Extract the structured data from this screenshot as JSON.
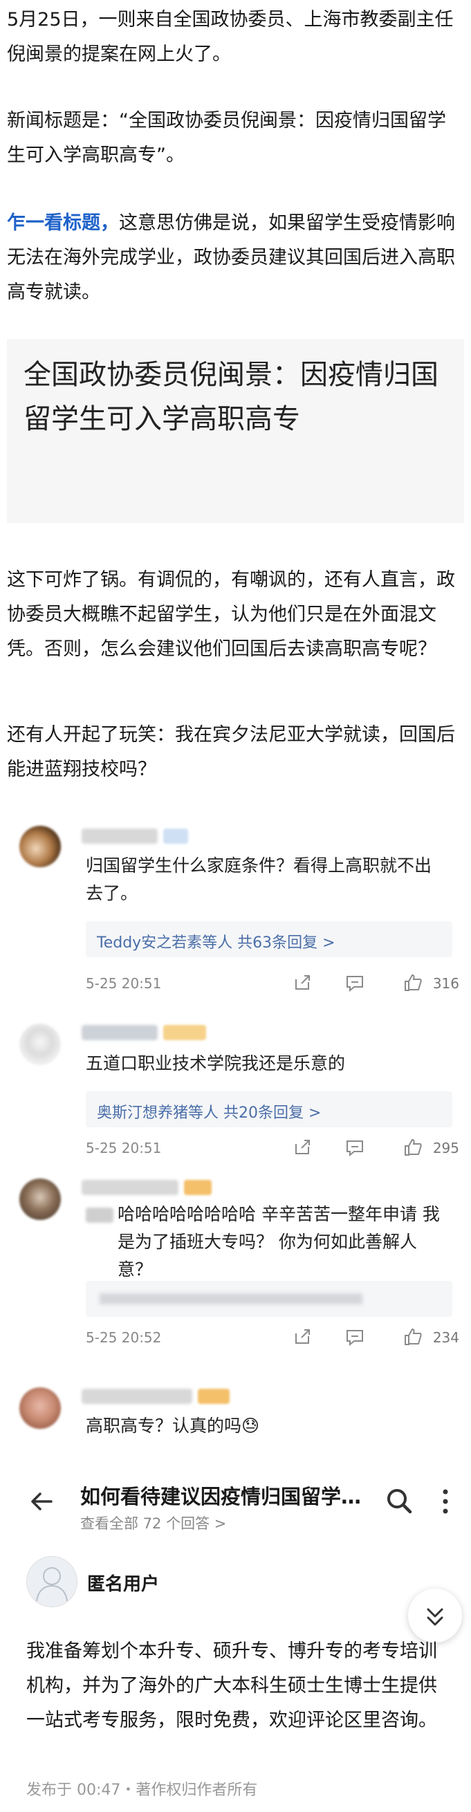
{
  "article": {
    "p1": "5月25日，一则来自全国政协委员、上海市教委副主任倪闽景的提案在网上火了。",
    "p2": "新闻标题是：“全国政协委员倪闽景：因疫情归国留学生可入学高职高专”。",
    "p3_highlight": "乍一看标题，",
    "p3_rest": "这意思仿佛是说，如果留学生受疫情影响无法在海外完成学业，政协委员建议其回国后进入高职高专就读。",
    "quote": "全国政协委员倪闽景：因疫情归国留学生可入学高职高专",
    "p4": "这下可炸了锅。有调侃的，有嘲讽的，还有人直言，政协委员大概瞧不起留学生，认为他们只是在外面混文凭。否则，怎么会建议他们回国后去读高职高专呢？",
    "p5": "还有人开起了玩笑：我在宾夕法尼亚大学就读，回国后能进蓝翔技校吗？",
    "highlight_color": "#1f62c9"
  },
  "comments": [
    {
      "text": "归国留学生什么家庭条件？看得上高职就不出去了。",
      "replies": "Teddy安之若素等人 共63条回复 >",
      "time": "5-25 20:51",
      "likes": "316"
    },
    {
      "text": "五道口职业技术学院我还是乐意的",
      "replies": "奥斯汀想养猪等人 共20条回复 >",
      "time": "5-25 20:51",
      "likes": "295"
    },
    {
      "text": "哈哈哈哈哈哈哈哈 辛辛苦苦一整年申请 我是为了插班大专吗？ 你为何如此善解人意？",
      "time": "5-25 20:52",
      "likes": "234"
    },
    {
      "text": "高职高专？认真的吗😓"
    }
  ],
  "zhihu": {
    "title": "如何看待建议因疫情归国留学…",
    "subtitle": "查看全部 72 个回答 >",
    "user": "匿名用户",
    "body": "我准备筹划个本升专、硕升专、博升专的考专培训机构，并为了海外的广大本科生硕士生博士生提供一站式考专服务，限时免费，欢迎评论区里咨询。",
    "footer": "发布于 00:47・著作权归作者所有"
  },
  "icons": [
    "share-icon",
    "comment-icon",
    "thumbs-up-icon",
    "back-arrow-icon",
    "search-icon",
    "more-icon",
    "collapse-icon",
    "anonymous-avatar-icon"
  ]
}
